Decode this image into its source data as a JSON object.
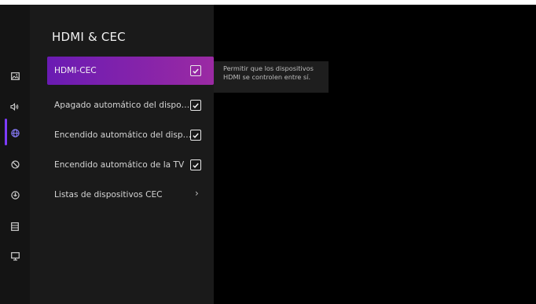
{
  "colors": {
    "accent_start": "#6a1bb3",
    "accent_end": "#9b2aa3",
    "rail_active": "#7e3cff"
  },
  "sidebar": {
    "icons": [
      {
        "name": "picture-icon",
        "active": false
      },
      {
        "name": "sound-icon",
        "active": false
      },
      {
        "name": "globe-icon",
        "active": true
      },
      {
        "name": "accessibility-icon",
        "active": false
      },
      {
        "name": "power-icon",
        "active": false
      },
      {
        "name": "list-icon",
        "active": false
      },
      {
        "name": "monitor-icon",
        "active": false
      }
    ]
  },
  "panel": {
    "title": "HDMI & CEC",
    "items": [
      {
        "label": "HDMI-CEC",
        "type": "checkbox",
        "checked": true,
        "focused": true
      },
      {
        "label": "Apagado automático del dispo…",
        "type": "checkbox",
        "checked": true,
        "focused": false
      },
      {
        "label": "Encendido automático del disp…",
        "type": "checkbox",
        "checked": true,
        "focused": false
      },
      {
        "label": "Encendido automático de la TV",
        "type": "checkbox",
        "checked": true,
        "focused": false
      },
      {
        "label": "Listas de dispositivos CEC",
        "type": "submenu",
        "focused": false
      }
    ]
  },
  "description": {
    "line1": "Permitir que los dispositivos",
    "line2": "HDMI se controlen entre sí."
  }
}
